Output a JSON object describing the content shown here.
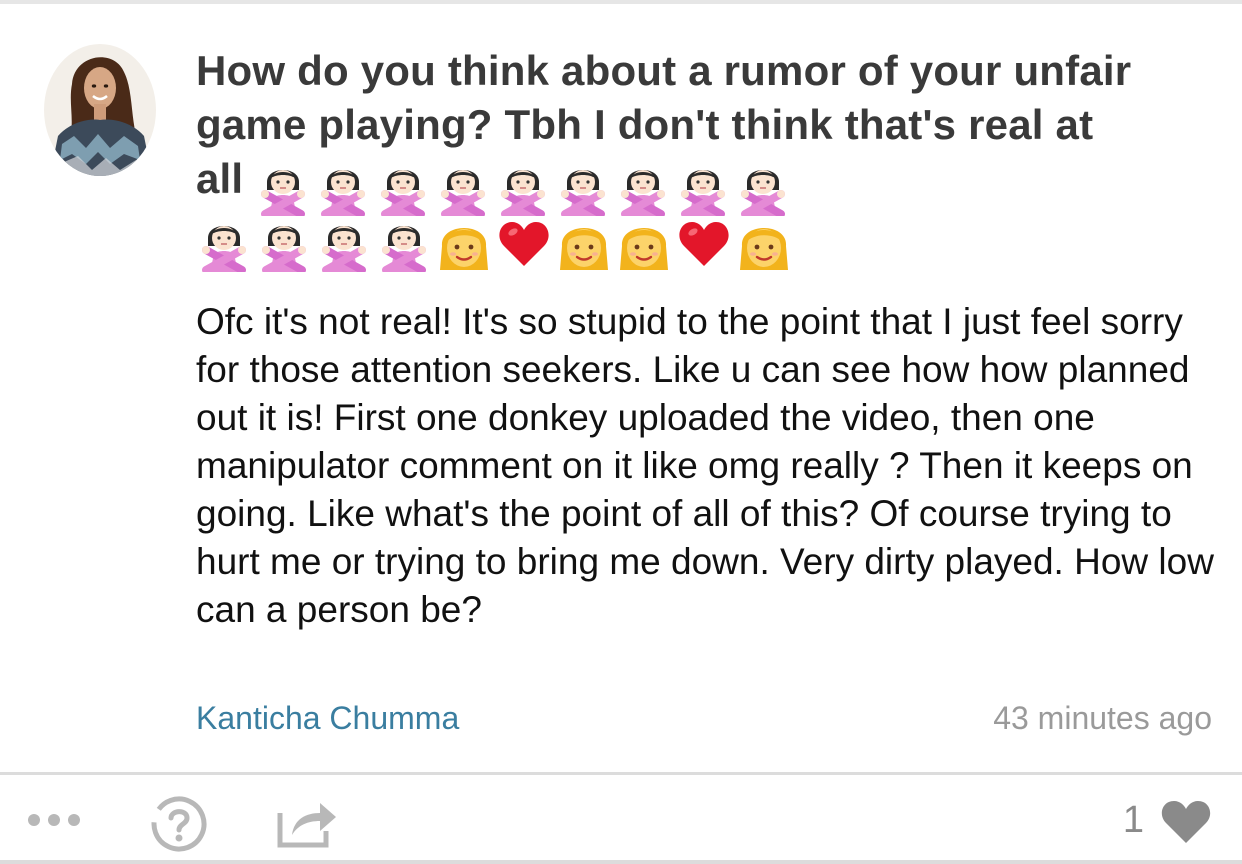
{
  "post": {
    "question_text": "How do you think about a rumor of your unfair game playing? Tbh I don't think that's real at all",
    "question_emojis": [
      "no-gesture-woman",
      "no-gesture-woman",
      "no-gesture-woman",
      "no-gesture-woman",
      "no-gesture-woman",
      "no-gesture-woman",
      "no-gesture-woman",
      "no-gesture-woman",
      "no-gesture-woman",
      "no-gesture-woman",
      "no-gesture-woman",
      "no-gesture-woman",
      "no-gesture-woman",
      "woman-face",
      "red-heart",
      "woman-face",
      "woman-face",
      "red-heart",
      "woman-face"
    ],
    "answer_text": "Ofc it's not real! It's so stupid to the point that I just feel sorry for those attention seekers. Like u can see how how planned out it is! First one donkey uploaded the video, then one manipulator comment on it like omg really ? Then it keeps on going. Like what's the point of all of this? Of course trying to hurt me or trying to bring me down. Very dirty played. How low can a person be?",
    "author": "Kanticha Chumma",
    "timestamp": "43 minutes ago"
  },
  "toolbar": {
    "more_icon": "more-dots-icon",
    "help_icon": "question-circle-icon",
    "share_icon": "share-icon",
    "like_count": "1",
    "heart_icon": "heart-icon"
  },
  "colors": {
    "question": "#3a3a3a",
    "answer": "#111111",
    "author_link": "#3a7ea0",
    "timestamp": "#9a9a9a",
    "icons": "#8a8a8a"
  }
}
